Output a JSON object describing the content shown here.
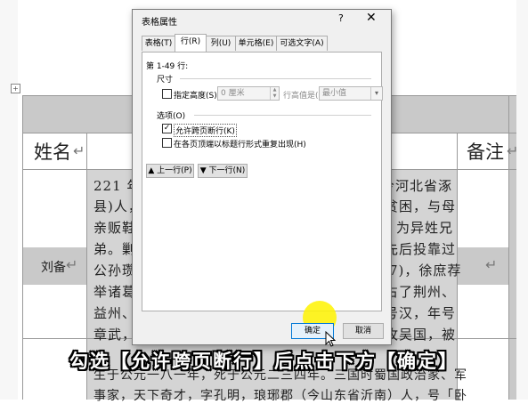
{
  "document": {
    "col_name_header": "姓名",
    "col_note_header": "备注",
    "para_mark": "↵",
    "row_name": "刘备",
    "bio_lines": [
      "221 年至",
      "县)人，",
      "亲贩鞋子",
      "弟。剿除",
      "公孙瓒、",
      "举诸葛亮",
      "益州、汉",
      "章武，史",
      "生于公元一八一年，死于公元二三四年。三国时蜀国政治家、军",
      "事家，天下奇才，字孔明，琅琊郡（今山东省沂南）人，号「卧"
    ],
    "bio_right_parts": [
      "今河北省涿",
      "贫困，与母",
      "为异姓兄",
      "先后投靠过",
      "7)，徐庶荐",
      "占了荆州、",
      "号汉，年号",
      "攻吴国，被"
    ]
  },
  "dialog": {
    "title": "表格属性",
    "help": "?",
    "close": "✕",
    "tabs": [
      "表格(T)",
      "行(R)",
      "列(U)",
      "单元格(E)",
      "可选文字(A)"
    ],
    "rows_label": "第 1-49 行:",
    "size_group": "尺寸",
    "specify_height_label": "指定高度(S):",
    "height_value": "0 厘米",
    "row_height_is_label": "行高值是(I):",
    "row_height_is_value": "最小值",
    "options_group": "选项(O)",
    "allow_break_label": "允许跨页断行(K)",
    "allow_break_checked": true,
    "repeat_header_label": "在各页顶端以标题行形式重复出现(H)",
    "repeat_header_checked": false,
    "prev_row_button": "上一行(P)",
    "next_row_button": "下一行(N)",
    "ok_button": "确定",
    "cancel_button": "取消"
  },
  "caption": "勾选【允许跨页断行】后点击下方【确定】",
  "colors": {
    "highlight": "#fff300",
    "ok_border": "#0078d7",
    "header_shade": "#c9c9c9"
  }
}
